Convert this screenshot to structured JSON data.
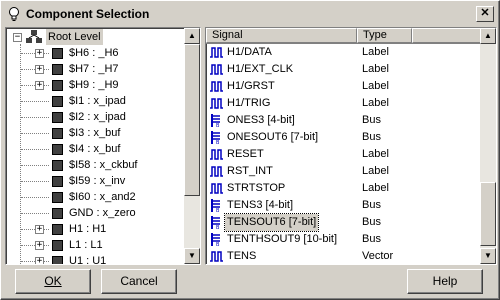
{
  "window": {
    "title": "Component Selection"
  },
  "tree": {
    "root_label": "Root Level",
    "items": [
      {
        "label": "$H6 : _H6",
        "expander": "+"
      },
      {
        "label": "$H7 : _H7",
        "expander": "+"
      },
      {
        "label": "$H9 : _H9",
        "expander": "+"
      },
      {
        "label": "$I1 : x_ipad",
        "expander": ""
      },
      {
        "label": "$I2 : x_ipad",
        "expander": ""
      },
      {
        "label": "$I3 : x_buf",
        "expander": ""
      },
      {
        "label": "$I4 : x_buf",
        "expander": ""
      },
      {
        "label": "$I58 : x_ckbuf",
        "expander": ""
      },
      {
        "label": "$I59 : x_inv",
        "expander": ""
      },
      {
        "label": "$I60 : x_and2",
        "expander": ""
      },
      {
        "label": "GND : x_zero",
        "expander": ""
      },
      {
        "label": "H1 : H1",
        "expander": "+"
      },
      {
        "label": "L1 : L1",
        "expander": "+"
      },
      {
        "label": "U1 : U1",
        "expander": "+"
      }
    ]
  },
  "list": {
    "headers": {
      "signal": "Signal",
      "type": "Type"
    },
    "rows": [
      {
        "signal": "H1/DATA",
        "type": "Label",
        "icon": "pulse"
      },
      {
        "signal": "H1/EXT_CLK",
        "type": "Label",
        "icon": "pulse"
      },
      {
        "signal": "H1/GRST",
        "type": "Label",
        "icon": "pulse"
      },
      {
        "signal": "H1/TRIG",
        "type": "Label",
        "icon": "pulse"
      },
      {
        "signal": "ONES3 [4-bit]",
        "type": "Bus",
        "icon": "bus"
      },
      {
        "signal": "ONESOUT6 [7-bit]",
        "type": "Bus",
        "icon": "bus"
      },
      {
        "signal": "RESET",
        "type": "Label",
        "icon": "pulse"
      },
      {
        "signal": "RST_INT",
        "type": "Label",
        "icon": "pulse"
      },
      {
        "signal": "STRTSTOP",
        "type": "Label",
        "icon": "pulse"
      },
      {
        "signal": "TENS3 [4-bit]",
        "type": "Bus",
        "icon": "bus"
      },
      {
        "signal": "TENSOUT6 [7-bit]",
        "type": "Bus",
        "icon": "bus",
        "selected": true
      },
      {
        "signal": "TENTHSOUT9 [10-bit]",
        "type": "Bus",
        "icon": "bus"
      },
      {
        "signal": "TENS",
        "type": "Vector",
        "icon": "pulse"
      }
    ]
  },
  "buttons": {
    "ok": "OK",
    "cancel": "Cancel",
    "help": "Help"
  },
  "colors": {
    "icon_blue": "#0000c0",
    "face": "#d4d0c8"
  }
}
